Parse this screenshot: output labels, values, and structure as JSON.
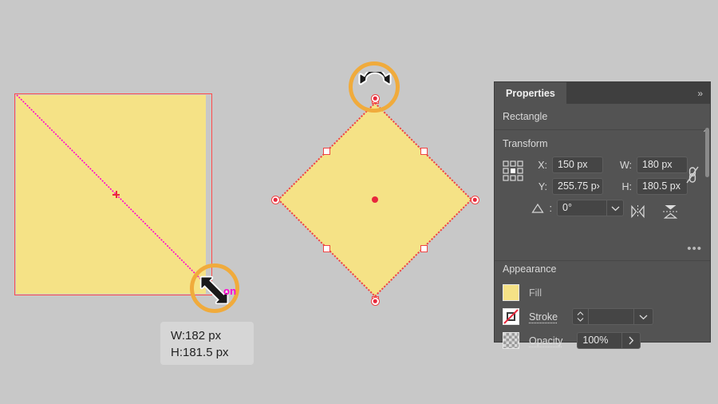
{
  "app": {
    "background_color": "#c8c8c8",
    "shape_fill_color": "#f5e286",
    "bbox_color": "#ff4b4b",
    "smart_guide_color": "#ff00d0",
    "highlight_ring_color": "#f0ab3c"
  },
  "canvas": {
    "original_shape": {
      "name": "rectangle-original",
      "cursor": "diagonal-resize-cursor",
      "smart_guide_label": "on"
    },
    "rotated_shape": {
      "name": "rectangle-rotated-45",
      "cursor": "rotate-cursor"
    },
    "measurement_tooltip": {
      "width_text": "W:182 px",
      "height_text": "H:181.5 px"
    }
  },
  "panel": {
    "tab_label": "Properties",
    "collapse_icon": "double-chevron-right-icon",
    "object_type": "Rectangle",
    "transform": {
      "heading": "Transform",
      "reference_point_icon": "reference-point-grid-icon",
      "fields": [
        {
          "label": "X:",
          "value": "150 px"
        },
        {
          "label": "W:",
          "value": "180 px"
        },
        {
          "label": "Y:",
          "value": "255.75 p›"
        },
        {
          "label": "H:",
          "value": "180.5 px"
        }
      ],
      "angle": {
        "label_icon": "angle-icon",
        "value": "0°",
        "dropdown_icon": "chevron-down-icon"
      },
      "link_icon": "broken-chain-link-icon",
      "flip_horizontal_icon": "flip-horizontal-icon",
      "flip_vertical_icon": "flip-vertical-icon",
      "more_options": "•••"
    },
    "appearance": {
      "heading": "Appearance",
      "fill": {
        "label": "Fill",
        "swatch_icon": "fill-swatch-icon",
        "color": "#f5e286"
      },
      "stroke": {
        "label": "Stroke",
        "swatch_icon": "stroke-none-swatch-icon",
        "weight_value": "",
        "stepper_icon": "stepper-icon",
        "dropdown_icon": "chevron-down-icon"
      },
      "opacity": {
        "label": "Opacity",
        "swatch_icon": "transparency-checker-icon",
        "value": "100%",
        "arrow_icon": "chevron-right-icon"
      }
    },
    "scroll_up_icon": "chevron-up-icon"
  }
}
